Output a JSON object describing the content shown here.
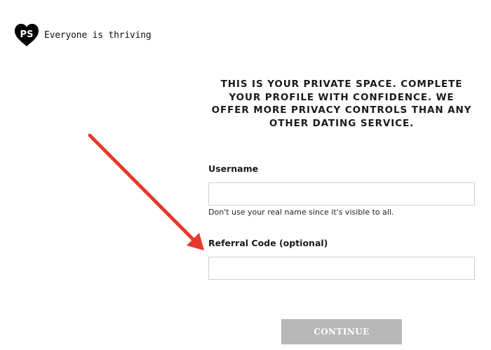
{
  "brand": {
    "logo_text": "PS",
    "tagline": "Everyone is thriving",
    "logo_icon": "heart-icon",
    "logo_color": "#000000"
  },
  "headline": "THIS IS YOUR PRIVATE SPACE. COMPLETE YOUR PROFILE WITH CONFIDENCE. WE OFFER MORE PRIVACY CONTROLS THAN ANY OTHER DATING SERVICE.",
  "form": {
    "username_label": "Username",
    "username_value": "",
    "username_hint": "Don't use your real name since it's visible to all.",
    "referral_label": "Referral Code (optional)",
    "referral_value": "",
    "continue_label": "CONTINUE"
  },
  "colors": {
    "annotation_arrow": "#e53a2b",
    "button_disabled": "#b8b8b8",
    "input_border": "#cfcfcf"
  }
}
